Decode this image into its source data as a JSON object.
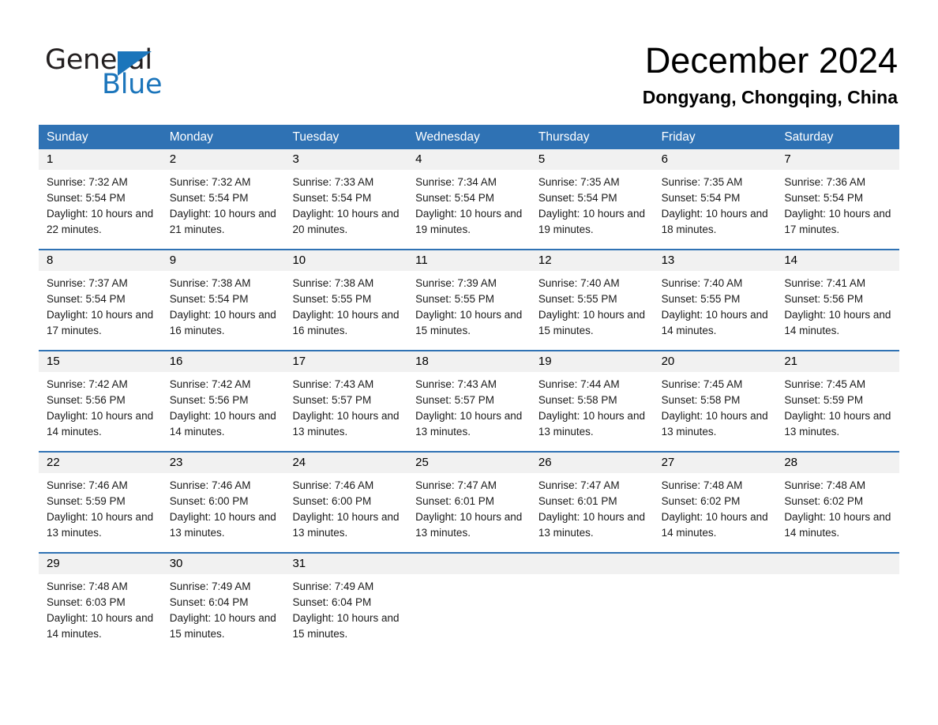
{
  "logo": {
    "word_general": "General",
    "word_blue": "Blue",
    "triangle": "blue-triangle-icon"
  },
  "header": {
    "month_title": "December 2024",
    "location": "Dongyang, Chongqing, China"
  },
  "colors": {
    "header_blue": "#2f72b4",
    "row_divider_blue": "#2f72b4",
    "day_number_bg": "#f1f1f1",
    "logo_blue": "#1b75bb",
    "text": "#000000"
  },
  "calendar": {
    "weekdays": [
      "Sunday",
      "Monday",
      "Tuesday",
      "Wednesday",
      "Thursday",
      "Friday",
      "Saturday"
    ],
    "weeks": [
      [
        {
          "day": "1",
          "sunrise": "Sunrise: 7:32 AM",
          "sunset": "Sunset: 5:54 PM",
          "daylight": "Daylight: 10 hours and 22 minutes."
        },
        {
          "day": "2",
          "sunrise": "Sunrise: 7:32 AM",
          "sunset": "Sunset: 5:54 PM",
          "daylight": "Daylight: 10 hours and 21 minutes."
        },
        {
          "day": "3",
          "sunrise": "Sunrise: 7:33 AM",
          "sunset": "Sunset: 5:54 PM",
          "daylight": "Daylight: 10 hours and 20 minutes."
        },
        {
          "day": "4",
          "sunrise": "Sunrise: 7:34 AM",
          "sunset": "Sunset: 5:54 PM",
          "daylight": "Daylight: 10 hours and 19 minutes."
        },
        {
          "day": "5",
          "sunrise": "Sunrise: 7:35 AM",
          "sunset": "Sunset: 5:54 PM",
          "daylight": "Daylight: 10 hours and 19 minutes."
        },
        {
          "day": "6",
          "sunrise": "Sunrise: 7:35 AM",
          "sunset": "Sunset: 5:54 PM",
          "daylight": "Daylight: 10 hours and 18 minutes."
        },
        {
          "day": "7",
          "sunrise": "Sunrise: 7:36 AM",
          "sunset": "Sunset: 5:54 PM",
          "daylight": "Daylight: 10 hours and 17 minutes."
        }
      ],
      [
        {
          "day": "8",
          "sunrise": "Sunrise: 7:37 AM",
          "sunset": "Sunset: 5:54 PM",
          "daylight": "Daylight: 10 hours and 17 minutes."
        },
        {
          "day": "9",
          "sunrise": "Sunrise: 7:38 AM",
          "sunset": "Sunset: 5:54 PM",
          "daylight": "Daylight: 10 hours and 16 minutes."
        },
        {
          "day": "10",
          "sunrise": "Sunrise: 7:38 AM",
          "sunset": "Sunset: 5:55 PM",
          "daylight": "Daylight: 10 hours and 16 minutes."
        },
        {
          "day": "11",
          "sunrise": "Sunrise: 7:39 AM",
          "sunset": "Sunset: 5:55 PM",
          "daylight": "Daylight: 10 hours and 15 minutes."
        },
        {
          "day": "12",
          "sunrise": "Sunrise: 7:40 AM",
          "sunset": "Sunset: 5:55 PM",
          "daylight": "Daylight: 10 hours and 15 minutes."
        },
        {
          "day": "13",
          "sunrise": "Sunrise: 7:40 AM",
          "sunset": "Sunset: 5:55 PM",
          "daylight": "Daylight: 10 hours and 14 minutes."
        },
        {
          "day": "14",
          "sunrise": "Sunrise: 7:41 AM",
          "sunset": "Sunset: 5:56 PM",
          "daylight": "Daylight: 10 hours and 14 minutes."
        }
      ],
      [
        {
          "day": "15",
          "sunrise": "Sunrise: 7:42 AM",
          "sunset": "Sunset: 5:56 PM",
          "daylight": "Daylight: 10 hours and 14 minutes."
        },
        {
          "day": "16",
          "sunrise": "Sunrise: 7:42 AM",
          "sunset": "Sunset: 5:56 PM",
          "daylight": "Daylight: 10 hours and 14 minutes."
        },
        {
          "day": "17",
          "sunrise": "Sunrise: 7:43 AM",
          "sunset": "Sunset: 5:57 PM",
          "daylight": "Daylight: 10 hours and 13 minutes."
        },
        {
          "day": "18",
          "sunrise": "Sunrise: 7:43 AM",
          "sunset": "Sunset: 5:57 PM",
          "daylight": "Daylight: 10 hours and 13 minutes."
        },
        {
          "day": "19",
          "sunrise": "Sunrise: 7:44 AM",
          "sunset": "Sunset: 5:58 PM",
          "daylight": "Daylight: 10 hours and 13 minutes."
        },
        {
          "day": "20",
          "sunrise": "Sunrise: 7:45 AM",
          "sunset": "Sunset: 5:58 PM",
          "daylight": "Daylight: 10 hours and 13 minutes."
        },
        {
          "day": "21",
          "sunrise": "Sunrise: 7:45 AM",
          "sunset": "Sunset: 5:59 PM",
          "daylight": "Daylight: 10 hours and 13 minutes."
        }
      ],
      [
        {
          "day": "22",
          "sunrise": "Sunrise: 7:46 AM",
          "sunset": "Sunset: 5:59 PM",
          "daylight": "Daylight: 10 hours and 13 minutes."
        },
        {
          "day": "23",
          "sunrise": "Sunrise: 7:46 AM",
          "sunset": "Sunset: 6:00 PM",
          "daylight": "Daylight: 10 hours and 13 minutes."
        },
        {
          "day": "24",
          "sunrise": "Sunrise: 7:46 AM",
          "sunset": "Sunset: 6:00 PM",
          "daylight": "Daylight: 10 hours and 13 minutes."
        },
        {
          "day": "25",
          "sunrise": "Sunrise: 7:47 AM",
          "sunset": "Sunset: 6:01 PM",
          "daylight": "Daylight: 10 hours and 13 minutes."
        },
        {
          "day": "26",
          "sunrise": "Sunrise: 7:47 AM",
          "sunset": "Sunset: 6:01 PM",
          "daylight": "Daylight: 10 hours and 13 minutes."
        },
        {
          "day": "27",
          "sunrise": "Sunrise: 7:48 AM",
          "sunset": "Sunset: 6:02 PM",
          "daylight": "Daylight: 10 hours and 14 minutes."
        },
        {
          "day": "28",
          "sunrise": "Sunrise: 7:48 AM",
          "sunset": "Sunset: 6:02 PM",
          "daylight": "Daylight: 10 hours and 14 minutes."
        }
      ],
      [
        {
          "day": "29",
          "sunrise": "Sunrise: 7:48 AM",
          "sunset": "Sunset: 6:03 PM",
          "daylight": "Daylight: 10 hours and 14 minutes."
        },
        {
          "day": "30",
          "sunrise": "Sunrise: 7:49 AM",
          "sunset": "Sunset: 6:04 PM",
          "daylight": "Daylight: 10 hours and 15 minutes."
        },
        {
          "day": "31",
          "sunrise": "Sunrise: 7:49 AM",
          "sunset": "Sunset: 6:04 PM",
          "daylight": "Daylight: 10 hours and 15 minutes."
        },
        {
          "day": "",
          "sunrise": "",
          "sunset": "",
          "daylight": ""
        },
        {
          "day": "",
          "sunrise": "",
          "sunset": "",
          "daylight": ""
        },
        {
          "day": "",
          "sunrise": "",
          "sunset": "",
          "daylight": ""
        },
        {
          "day": "",
          "sunrise": "",
          "sunset": "",
          "daylight": ""
        }
      ]
    ]
  }
}
